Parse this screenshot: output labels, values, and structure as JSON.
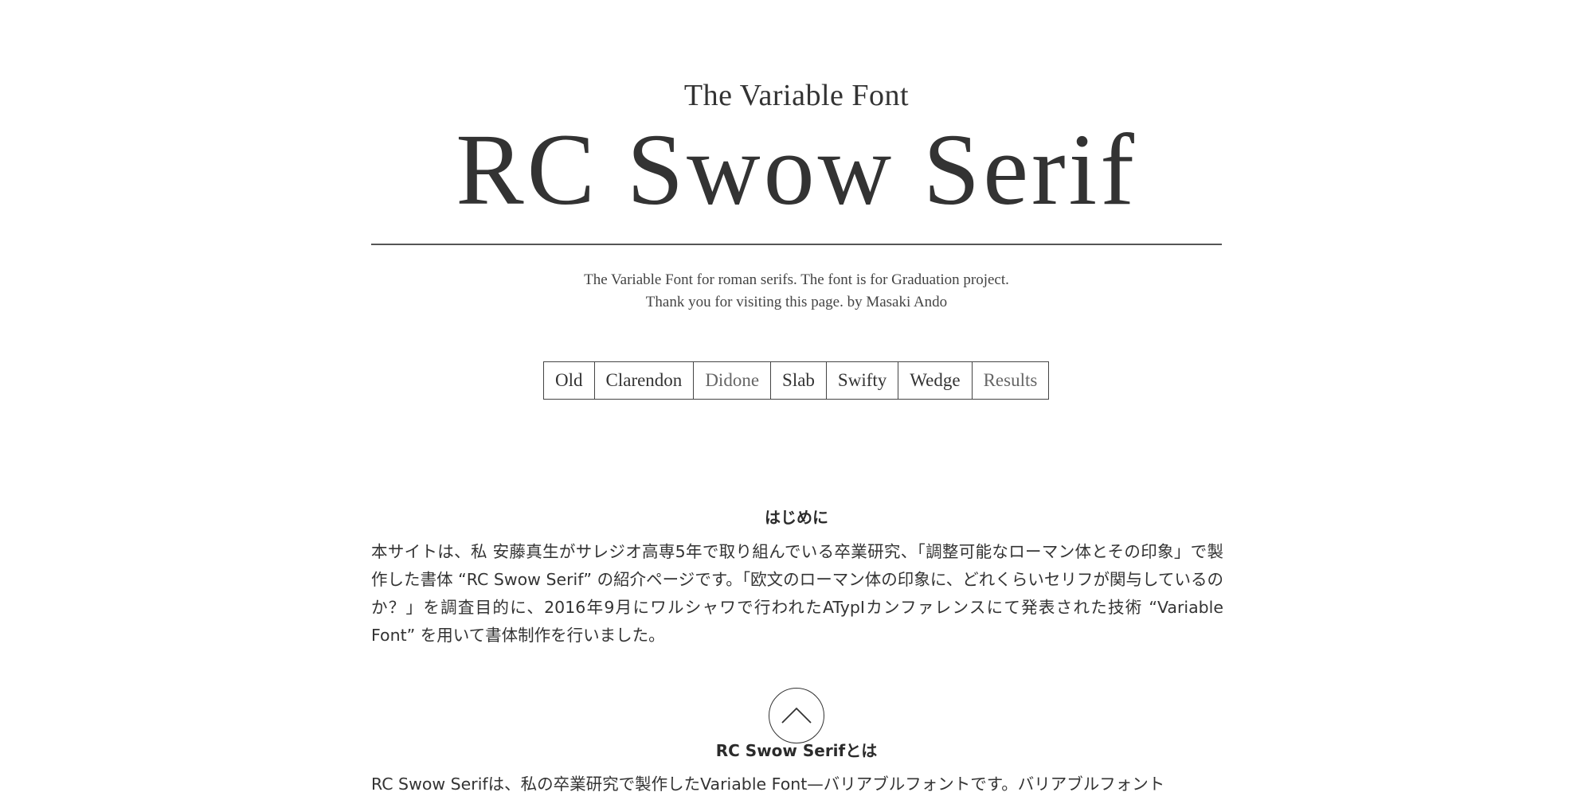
{
  "header": {
    "subtitle": "The Variable Font",
    "title": "RC Swow Serif"
  },
  "description": {
    "line1": "The Variable Font for roman serifs. The font is for Graduation project.",
    "line2": "Thank you for visiting this page. by Masaki Ando"
  },
  "nav": {
    "items": [
      {
        "label": "Old"
      },
      {
        "label": "Clarendon"
      },
      {
        "label": "Didone"
      },
      {
        "label": "Slab"
      },
      {
        "label": "Swifty"
      },
      {
        "label": "Wedge"
      },
      {
        "label": "Results"
      }
    ]
  },
  "intro": {
    "heading": "はじめに",
    "body": "本サイトは、私 安藤真生がサレジオ高専5年で取り組んでいる卒業研究、「調整可能なローマン体とその印象」で製作した書体 “RC Swow Serif” の紹介ページです。「欧文のローマン体の印象に、どれくらいセリフが関与しているのか？」を調査目的に、2016年9月にワルシャワで行われたATypIカンファレンスにて発表された技術 “Variable Font” を用いて書体制作を行いました。"
  },
  "about": {
    "heading": "RC Swow Serifとは",
    "body": "RC Swow Serifは、私の卒業研究で製作したVariable Font—バリアブルフォントです。バリアブルフォント"
  },
  "icons": {
    "back_to_top": "chevron-up-icon"
  }
}
